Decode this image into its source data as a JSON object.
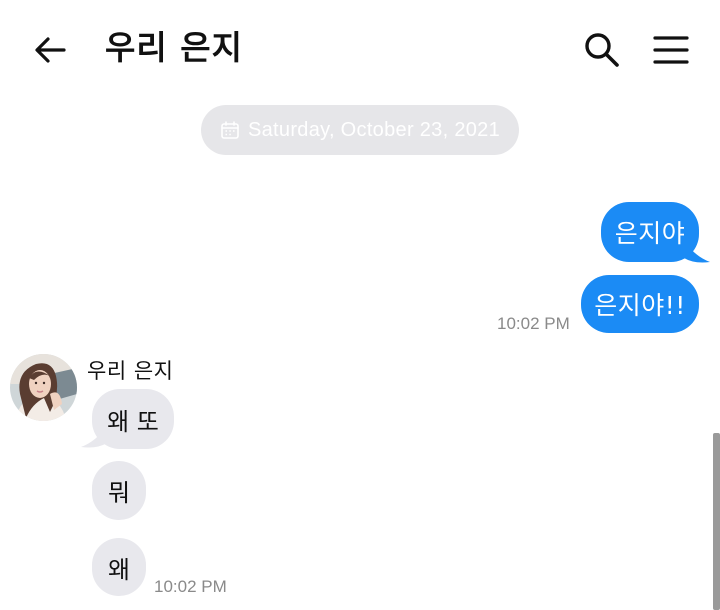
{
  "header": {
    "title": "우리 은지",
    "back_icon": "arrow-left-icon",
    "search_icon": "search-icon",
    "menu_icon": "hamburger-menu-icon"
  },
  "date_divider": {
    "text": "Saturday, October 23, 2021",
    "icon": "calendar-icon"
  },
  "outgoing": {
    "messages": [
      "은지야",
      "은지야!!"
    ],
    "time": "10:02 PM",
    "bubble_color": "#1b8bf5"
  },
  "incoming": {
    "sender": "우리 은지",
    "avatar": "avatar-photo",
    "messages": [
      "왜 또",
      "뭐",
      "왜"
    ],
    "time": "10:02 PM",
    "bubble_color": "#e8e8ed"
  },
  "colors": {
    "background": "#ffffff",
    "date_pill": "#e6e6e9",
    "timestamp": "#8a8a8a"
  }
}
